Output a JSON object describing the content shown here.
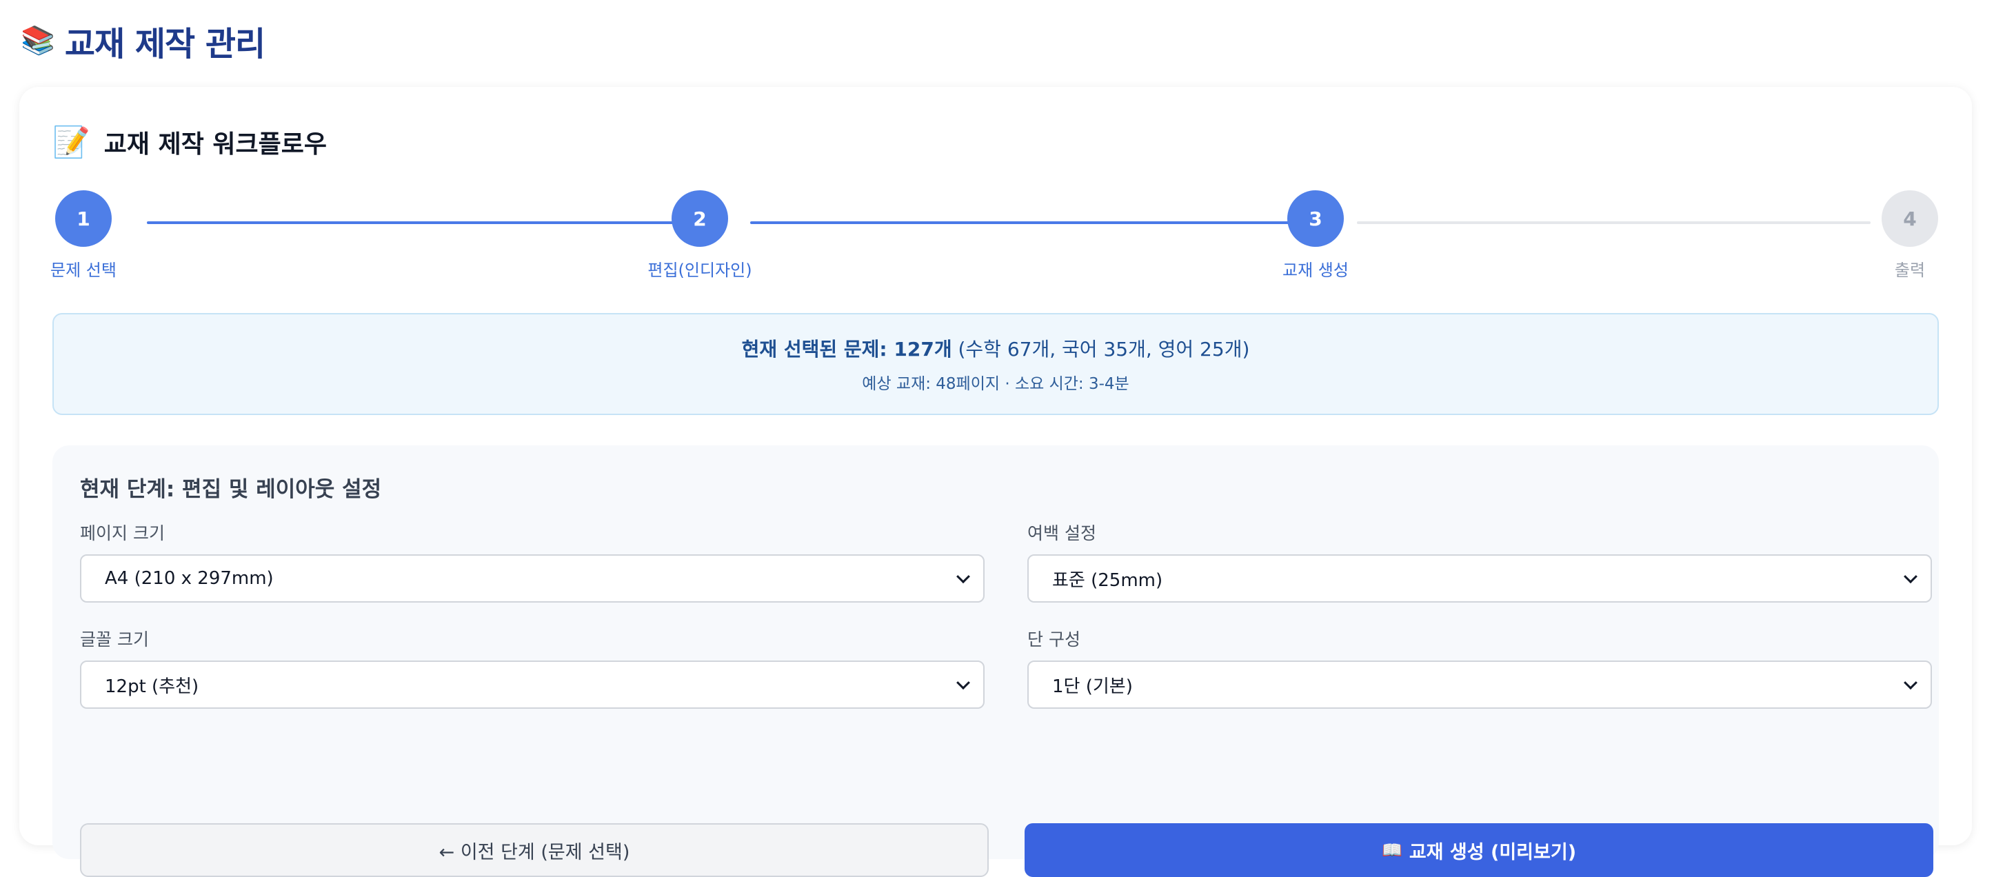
{
  "header": {
    "icon": "books-icon",
    "title": "교재 제작 관리"
  },
  "workflow": {
    "icon": "memo-icon",
    "title": "교재 제작 워크플로우",
    "steps": [
      {
        "number": "1",
        "label": "문제 선택",
        "state": "active"
      },
      {
        "number": "2",
        "label": "편집(인디자인)",
        "state": "active"
      },
      {
        "number": "3",
        "label": "교재 생성",
        "state": "active"
      },
      {
        "number": "4",
        "label": "출력",
        "state": "inactive"
      }
    ]
  },
  "summary": {
    "main_prefix": "현재 선택된 문제: 127개",
    "main_detail": " (수학 67개, 국어 35개, 영어 25개)",
    "sub": "예상 교재: 48페이지 · 소요 시간: 3-4분"
  },
  "settings": {
    "title": "현재 단계: 편집 및 레이아웃 설정",
    "page_size": {
      "label": "페이지 크기",
      "value": "A4 (210 x 297mm)"
    },
    "margin": {
      "label": "여백 설정",
      "value": "표준 (25mm)"
    },
    "font_size": {
      "label": "글꼴 크기",
      "value": "12pt (추천)"
    },
    "columns": {
      "label": "단 구성",
      "value": "1단 (기본)"
    },
    "prev_button": "← 이전 단계 (문제 선택)",
    "generate_icon": "open-book-icon",
    "generate_button": "교재 생성 (미리보기)"
  },
  "colors": {
    "primary": "#3a63e0",
    "step_active": "#4f7fe8",
    "step_inactive": "#e5e7eb",
    "title": "#1e3a8a"
  }
}
